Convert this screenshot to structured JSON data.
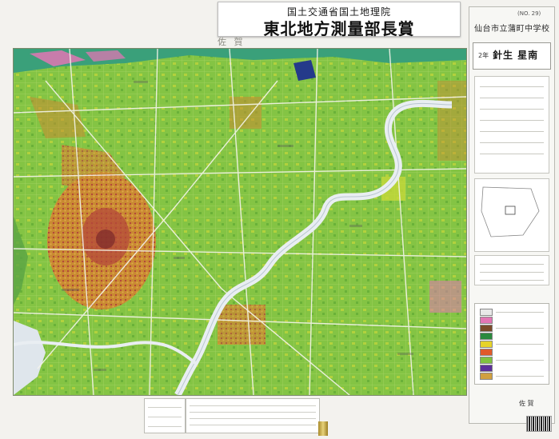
{
  "award": {
    "organization": "国土交通省国土地理院",
    "name": "東北地方測量部長賞"
  },
  "panel": {
    "number": "(NO. 29)",
    "school": "仙台市立蒲町中学校",
    "grade": "2年",
    "student": "針生 星南",
    "place_label": "佐 賀"
  },
  "map": {
    "title": "佐 賀",
    "colors": {
      "field": "#7fc23f",
      "paddy": "#c6d83a",
      "urban": "#c8892f",
      "dense": "#b4483a",
      "river": "#e9eef2",
      "sea": "#3aa07a",
      "shoal": "#4f8f55",
      "pink": "#e276b4",
      "roads": "#f4f4ea"
    }
  },
  "legend": {
    "swatches": [
      "#e8e8e8",
      "#e276b4",
      "#7a4b2a",
      "#2b8a3e",
      "#e6d329",
      "#e05a2a",
      "#7fc23f",
      "#5c2f9a",
      "#d0a040"
    ]
  }
}
